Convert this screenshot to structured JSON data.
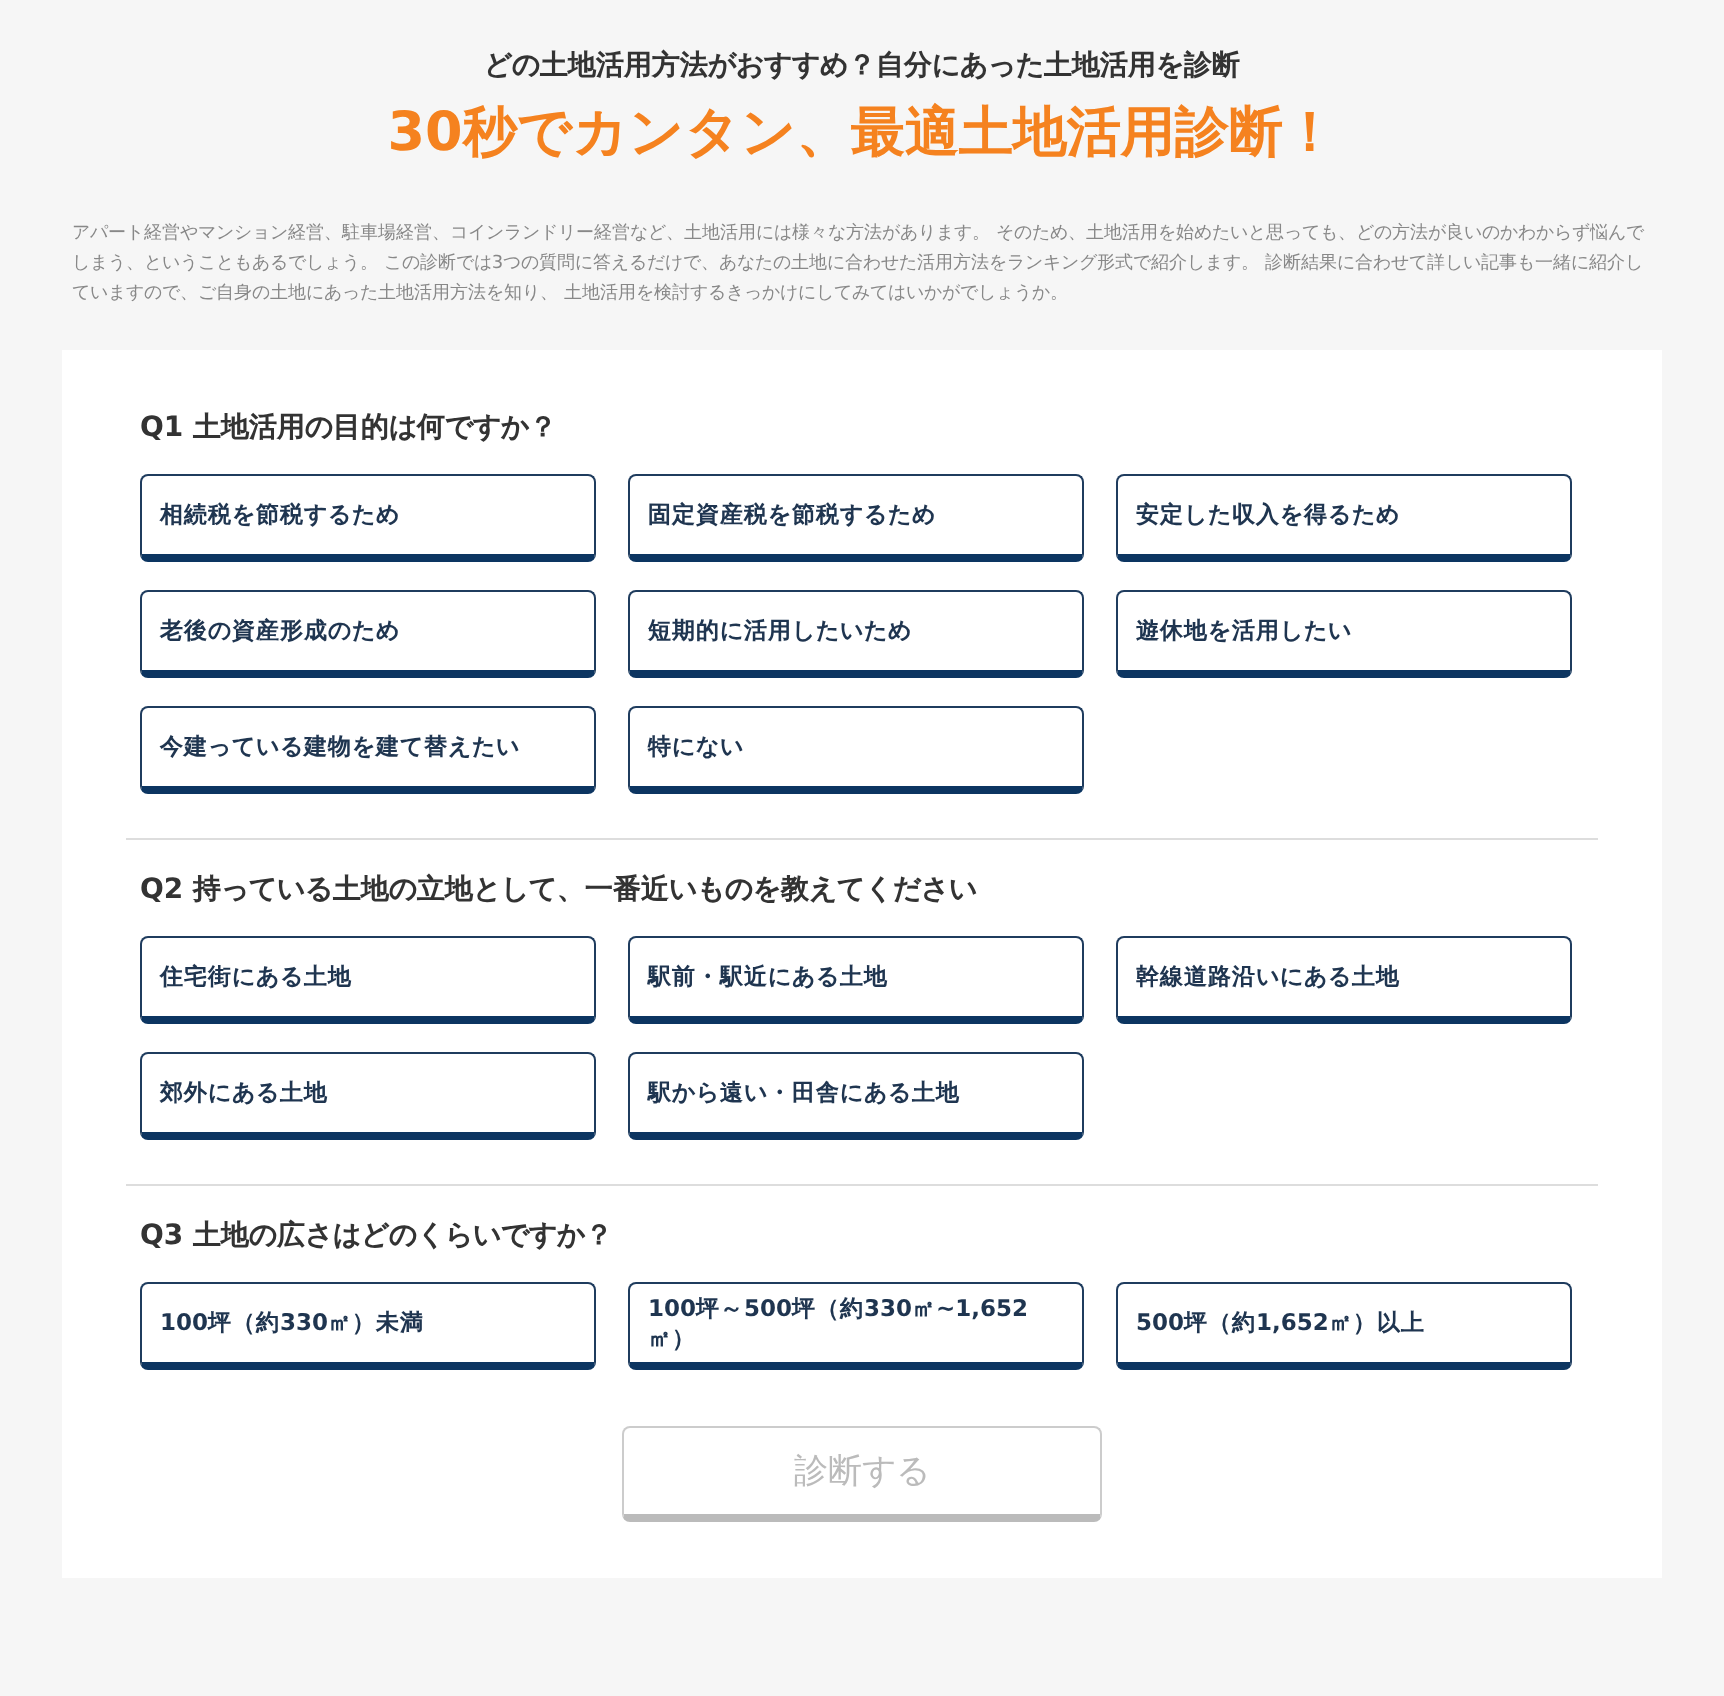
{
  "header": {
    "subtitle": "どの土地活用方法がおすすめ？自分にあった土地活用を診断",
    "title": "30秒でカンタン、最適土地活用診断！",
    "description": "アパート経営やマンション経営、駐車場経営、コインランドリー経営など、土地活用には様々な方法があります。 そのため、土地活用を始めたいと思っても、どの方法が良いのかわからず悩んでしまう、ということもあるでしょう。 この診断では3つの質問に答えるだけで、あなたの土地に合わせた活用方法をランキング形式で紹介します。 診断結果に合わせて詳しい記事も一緒に紹介していますので、ご自身の土地にあった土地活用方法を知り、 土地活用を検討するきっかけにしてみてはいかがでしょうか。"
  },
  "questions": [
    {
      "label": "Q1 土地活用の目的は何ですか？",
      "options": [
        {
          "label": "相続税を節税するため",
          "selected": false
        },
        {
          "label": "固定資産税を節税するため",
          "selected": false
        },
        {
          "label": "安定した収入を得るため",
          "selected": false
        },
        {
          "label": "老後の資産形成のため",
          "selected": false
        },
        {
          "label": "短期的に活用したいため",
          "selected": false
        },
        {
          "label": "遊休地を活用したい",
          "selected": false
        },
        {
          "label": "今建っている建物を建て替えたい",
          "selected": false
        },
        {
          "label": "特にない",
          "selected": false
        }
      ]
    },
    {
      "label": "Q2 持っている土地の立地として、一番近いものを教えてください",
      "options": [
        {
          "label": "住宅街にある土地",
          "selected": false
        },
        {
          "label": "駅前・駅近にある土地",
          "selected": false
        },
        {
          "label": "幹線道路沿いにある土地",
          "selected": false
        },
        {
          "label": "郊外にある土地",
          "selected": false
        },
        {
          "label": "駅から遠い・田舎にある土地",
          "selected": false
        }
      ]
    },
    {
      "label": "Q3 土地の広さはどのくらいですか？",
      "options": [
        {
          "label": "100坪（約330㎡）未満",
          "selected": false
        },
        {
          "label": "100坪～500坪（約330㎡~1,652㎡）",
          "selected": false
        },
        {
          "label": "500坪（約1,652㎡）以上",
          "selected": false
        }
      ]
    }
  ],
  "submit": {
    "label": "診断する",
    "disabled": true
  }
}
